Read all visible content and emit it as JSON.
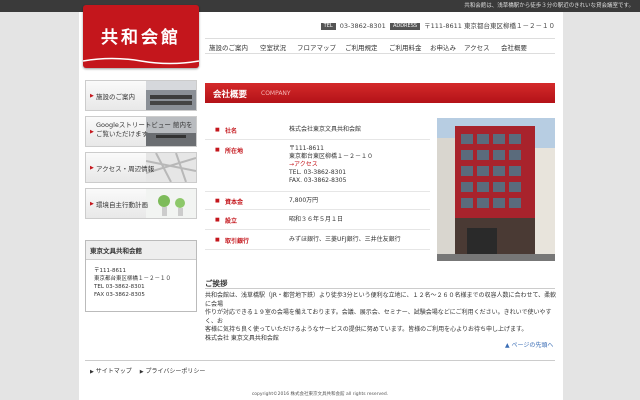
{
  "topbar": {
    "text": "共和会館は、浅草橋駅から徒歩３分の駅近のきれいな貸会議室です。"
  },
  "logo": {
    "text": "共和会館"
  },
  "contact": {
    "tel_tag": "TEL",
    "tel": "03-3862-8301",
    "address_tag": "ADDRESS",
    "address": "〒111-8611 東京都台東区柳橋１－２－１０"
  },
  "nav": [
    "施設のご案内",
    "空室状況",
    "フロアマップ",
    "ご利用規定",
    "ご利用料金",
    "お申込み",
    "アクセス",
    "会社概要"
  ],
  "sidebar": {
    "buttons": [
      "施設のご案内",
      "Googleストリートビュー 館内をご覧いただけます",
      "アクセス・周辺情報",
      "環境自主行動計画"
    ],
    "address_box": {
      "title": "東京文具共和会館",
      "lines": [
        "〒111-8611",
        "東京都台東区柳橋１－２－１０",
        "",
        "TEL 03-3862-8301",
        "FAX 03-3862-8305"
      ]
    }
  },
  "content": {
    "title": "会社概要",
    "subtitle": "COMPANY"
  },
  "company": [
    {
      "key": "社名",
      "values": [
        "株式会社東京文具共和会館"
      ]
    },
    {
      "key": "所在地",
      "values": [
        "〒111-8611",
        "東京都台東区柳橋１－２－１０",
        "→アクセス",
        "TEL. 03-3862-8301",
        "FAX. 03-3862-8305"
      ]
    },
    {
      "key": "資本金",
      "values": [
        "7,800万円"
      ]
    },
    {
      "key": "設立",
      "values": [
        "昭和３６年５月１日"
      ]
    },
    {
      "key": "取引銀行",
      "values": [
        "みずほ銀行、三菱UFJ銀行、三井住友銀行"
      ]
    }
  ],
  "greeting": {
    "title": "ご挨拶",
    "lines": [
      "共和会館は、浅草橋駅（JR・都営地下鉄）より徒歩3分という便利な立地に、１２名～２６０名様までの収容人数に合わせて、柔軟に会場",
      "作りが対応できる１９室の会場を備えております。会議、展示会、セミナー、試験会場などにご利用ください。きれいで使いやすく、お",
      "客様に気持ち良く使っていただけるようなサービスの提供に努めています。皆様のご利用を心よりお待ち申し上げます。",
      "株式会社 東京文具共和会館"
    ]
  },
  "pagetop": "ページの先頭へ",
  "footer": {
    "links": [
      "サイトマップ",
      "プライバシーポリシー"
    ],
    "copyright": "copyright©2016 株式会社東京文具共和会館 all rights reserved."
  },
  "colors": {
    "accent": "#c4161c",
    "link": "#3a6db5"
  }
}
